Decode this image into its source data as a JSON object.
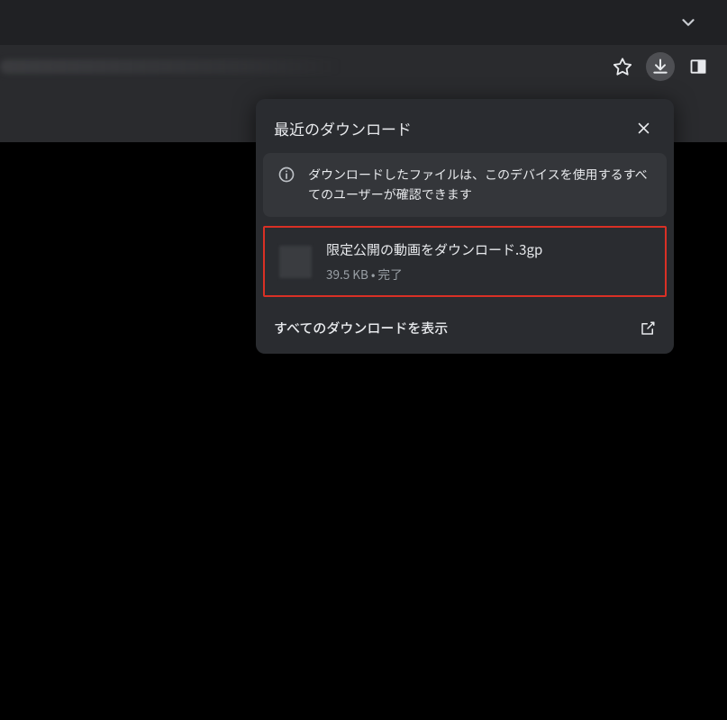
{
  "popup": {
    "title": "最近のダウンロード",
    "info": "ダウンロードしたファイルは、このデバイスを使用するすべてのユーザーが確認できます",
    "item": {
      "name": "限定公開の動画をダウンロード.3gp",
      "size": "39.5 KB",
      "sep": " • ",
      "status": "完了"
    },
    "footer": "すべてのダウンロードを表示"
  }
}
